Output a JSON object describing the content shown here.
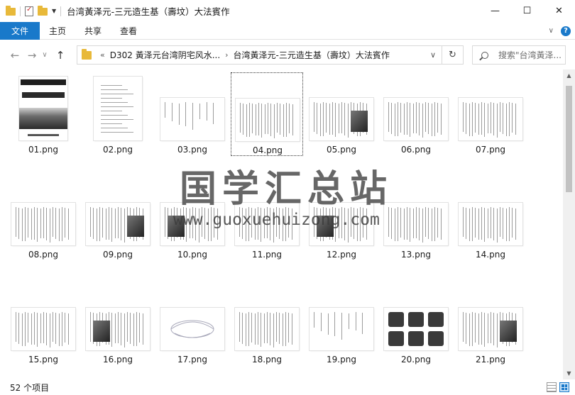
{
  "window": {
    "title": "台湾黃泽元-三元造生基（壽坟）大法賓作",
    "minimize_glyph": "—",
    "maximize_glyph": "☐",
    "close_glyph": "✕"
  },
  "ribbon": {
    "tabs": [
      "文件",
      "主页",
      "共享",
      "查看"
    ],
    "collapse_glyph": "∨",
    "help_glyph": "?"
  },
  "navigation": {
    "back_glyph": "←",
    "forward_glyph": "→",
    "recent_glyph": "∨",
    "up_glyph": "↑",
    "overflow_glyph": "«",
    "breadcrumb": [
      "D302 黃泽元台湾阴宅风水...",
      "台湾黃泽元-三元造生基（壽坟）大法賓作"
    ],
    "separator_glyph": "›",
    "dropdown_glyph": "∨",
    "refresh_glyph": "↻"
  },
  "search": {
    "placeholder": "搜索\"台湾黃泽..."
  },
  "files": [
    {
      "name": "01.png",
      "kind": "cover"
    },
    {
      "name": "02.png",
      "kind": "toc"
    },
    {
      "name": "03.png",
      "kind": "text-sparse"
    },
    {
      "name": "04.png",
      "kind": "text-dense",
      "selected": true
    },
    {
      "name": "05.png",
      "kind": "text-photo"
    },
    {
      "name": "06.png",
      "kind": "text-dense"
    },
    {
      "name": "07.png",
      "kind": "text-dense"
    },
    {
      "name": "08.png",
      "kind": "text-dense"
    },
    {
      "name": "09.png",
      "kind": "text-photo"
    },
    {
      "name": "10.png",
      "kind": "text-photo"
    },
    {
      "name": "11.png",
      "kind": "text-dense"
    },
    {
      "name": "12.png",
      "kind": "text-photo"
    },
    {
      "name": "13.png",
      "kind": "text-dense"
    },
    {
      "name": "14.png",
      "kind": "text-dense"
    },
    {
      "name": "15.png",
      "kind": "text-dense"
    },
    {
      "name": "16.png",
      "kind": "text-photo"
    },
    {
      "name": "17.png",
      "kind": "diagram"
    },
    {
      "name": "18.png",
      "kind": "text-dense"
    },
    {
      "name": "19.png",
      "kind": "text-sparse"
    },
    {
      "name": "20.png",
      "kind": "photo-grid"
    },
    {
      "name": "21.png",
      "kind": "text-photo"
    }
  ],
  "watermark": {
    "title": "国学汇总站",
    "url": "www.guoxuehuizong.com"
  },
  "status": {
    "item_count": "52 个项目"
  }
}
